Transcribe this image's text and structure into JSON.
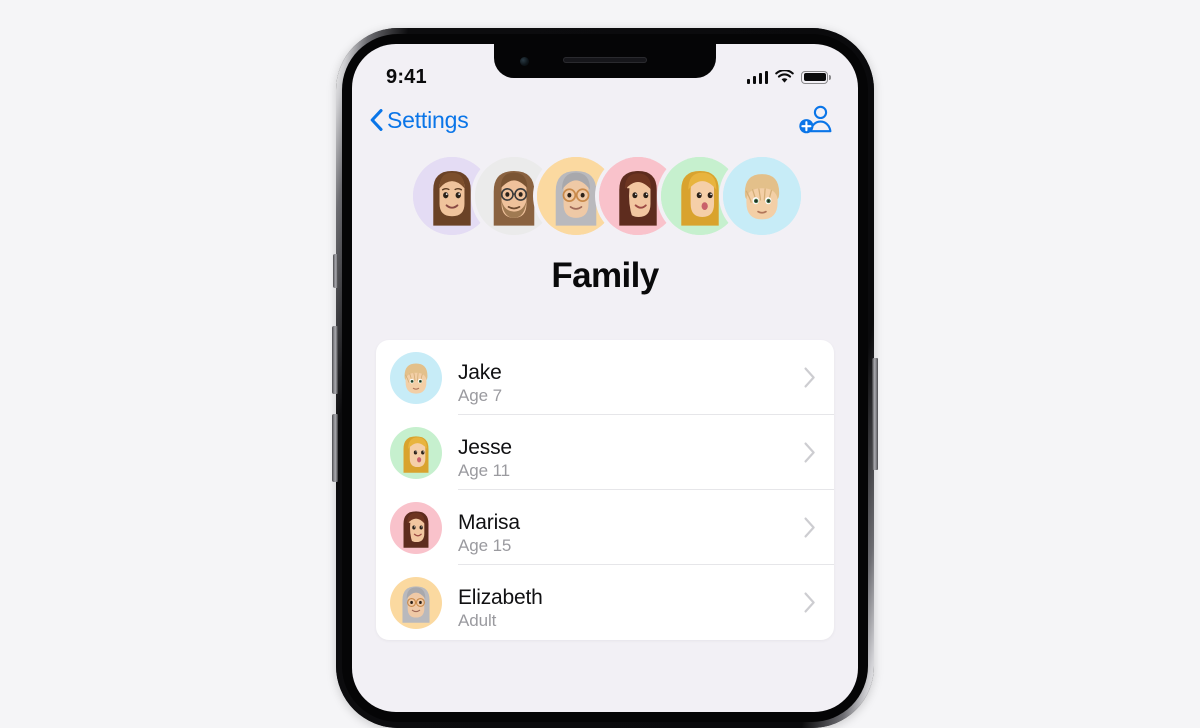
{
  "device": {
    "type": "iphone",
    "frame_color": "#0a0a0c"
  },
  "status_bar": {
    "time": "9:41",
    "signal_icon": "cellular-bars-icon",
    "signal_bars": 4,
    "wifi_icon": "wifi-icon",
    "battery_icon": "battery-icon",
    "battery_level": 100
  },
  "nav": {
    "back_icon": "chevron-left-icon",
    "back_label": "Settings",
    "action_icon": "add-person-icon"
  },
  "hero": {
    "title": "Family",
    "avatars": [
      {
        "name": "memoji-avatar-1",
        "bg": "#E4DCF4",
        "label": "Memoji woman with long brown hair"
      },
      {
        "name": "memoji-avatar-2",
        "bg": "#EBEBEB",
        "label": "Memoji person with beard and glasses"
      },
      {
        "name": "memoji-avatar-3",
        "bg": "#FBD9A0",
        "label": "Memoji older woman with grey hair and glasses"
      },
      {
        "name": "memoji-avatar-4",
        "bg": "#F9C2CB",
        "label": "Memoji woman with auburn hair"
      },
      {
        "name": "memoji-avatar-5",
        "bg": "#C6F0CE",
        "label": "Memoji girl with blonde hair"
      },
      {
        "name": "memoji-avatar-6",
        "bg": "#C7ECF7",
        "label": "Memoji boy with blonde hair"
      }
    ]
  },
  "list": {
    "rows": [
      {
        "name": "Jake",
        "detail": "Age 7",
        "avatar_bg": "#C7ECF7",
        "avatar": "memoji-jake",
        "chevron": "chevron-right-icon"
      },
      {
        "name": "Jesse",
        "detail": "Age 11",
        "avatar_bg": "#C6F0CE",
        "avatar": "memoji-jesse",
        "chevron": "chevron-right-icon"
      },
      {
        "name": "Marisa",
        "detail": "Age 15",
        "avatar_bg": "#F9C2CB",
        "avatar": "memoji-marisa",
        "chevron": "chevron-right-icon"
      },
      {
        "name": "Elizabeth",
        "detail": "Adult",
        "avatar_bg": "#FBD9A0",
        "avatar": "memoji-elizabeth",
        "chevron": "chevron-right-icon"
      }
    ]
  },
  "colors": {
    "accent_blue": "#0A75E8",
    "screen_bg": "#F2F0F5",
    "card_bg": "#FFFFFF",
    "page_bg": "#F5F5F7",
    "secondary_text": "#9A9A9F",
    "separator": "#E6E6E9"
  }
}
